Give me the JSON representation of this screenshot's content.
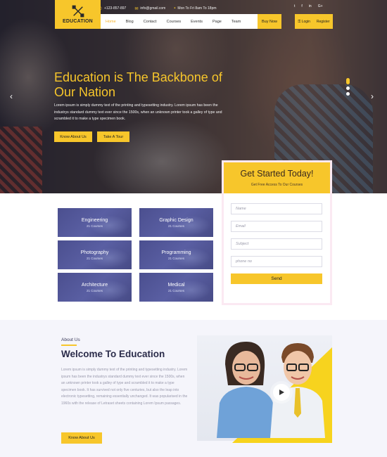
{
  "topbar": {
    "phone": "+123-857-897",
    "email": "info@gmail.com",
    "hours": "Mon To Fri 8am To 18pm"
  },
  "social": [
    "t",
    "f",
    "in",
    "G+"
  ],
  "logo": {
    "text": "EDUCATION"
  },
  "nav": {
    "items": [
      "Home",
      "Blog",
      "Contact",
      "Courses",
      "Events",
      "Page",
      "Team"
    ],
    "buy_now": "Buy Now",
    "login": "Login",
    "register": "Register"
  },
  "hero": {
    "title": "Education is The Backbone of Our Nation",
    "text": "Lorem ipsum is simply dummy text of the printing and typesetting industry. Lorem ipsum has been the industrys standard dummy text ever since the 1500s, when an unknown printer took a galley of type and scrambled it to make a type specimen book.",
    "button_about": "Know About Us",
    "button_tour": "Take A Tour"
  },
  "form": {
    "title": "Get Started Today!",
    "subtitle": "Get Free Access To Our Courses",
    "name_placeholder": "Name",
    "email_placeholder": "Email",
    "subject_placeholder": "Subject",
    "phone_placeholder": "phone no",
    "send": "Send"
  },
  "courses": [
    {
      "name": "Engineering",
      "count": "21 Courses"
    },
    {
      "name": "Graphic Design",
      "count": "21 Courses"
    },
    {
      "name": "Photography",
      "count": "21 Courses"
    },
    {
      "name": "Programming",
      "count": "21 Courses"
    },
    {
      "name": "Architecture",
      "count": "21 Courses"
    },
    {
      "name": "Medical",
      "count": "21 Courses"
    }
  ],
  "about": {
    "label": "About Us",
    "title": "Welcome To Education",
    "text": "Lorem ipsum is simply dummy text of the printing and typesetting industry. Lorem ipsum has been the industrys standard dummy text ever since the 1500s, when an unknown printer took a galley of type and scrambled it to make a type specimen book. It has survived not only five centuries, but also the leap into electronic typesetting, remaining essentially unchanged. It was popularised in the 1960s with the release of Letraset sheets containing Lorem Ipsum passages.",
    "button": "Know About Us"
  },
  "colors": {
    "accent": "#f7c62b",
    "tile": "#4b4f8f",
    "heading": "#2b2c4a"
  }
}
